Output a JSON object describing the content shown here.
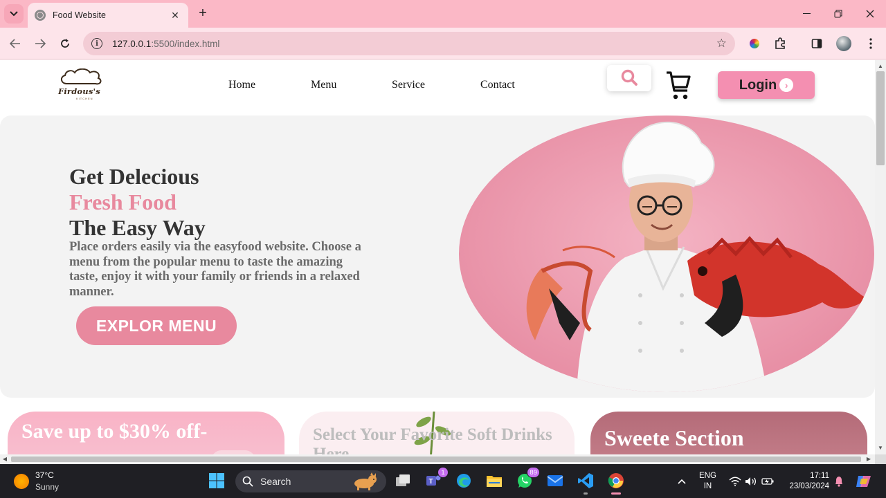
{
  "browser": {
    "tab_title": "Food Website",
    "url_host": "127.0.0.1",
    "url_path": ":5500/index.html"
  },
  "site": {
    "logo_text": "Firdous's",
    "logo_subtext": "KITCHEN",
    "nav": [
      "Home",
      "Menu",
      "Service",
      "Contact"
    ],
    "login_label": "Login"
  },
  "hero": {
    "line1": "Get Delecious",
    "line2": "Fresh Food",
    "line3": "The Easy Way",
    "description": "Place orders easily via the easyfood website. Choose a menu from the popular menu to taste the amazing taste, enjoy it with your family or friends in a relaxed manner.",
    "cta": "EXPLOR MENU"
  },
  "cards": [
    {
      "title": "Save up to $30% off-"
    },
    {
      "title": "Select Your Favorite Soft Drinks Here"
    },
    {
      "title": "Sweete Section"
    }
  ],
  "taskbar": {
    "temperature": "37°C",
    "condition": "Sunny",
    "search_label": "Search",
    "teams_badge": "1",
    "whatsapp_badge": "89",
    "lang_line1": "ENG",
    "lang_line2": "IN",
    "time": "17:11",
    "date": "23/03/2024"
  },
  "colors": {
    "accent_pink": "#e8899e",
    "login_pink": "#f48fb1",
    "tab_strip": "#fbb8c6"
  }
}
